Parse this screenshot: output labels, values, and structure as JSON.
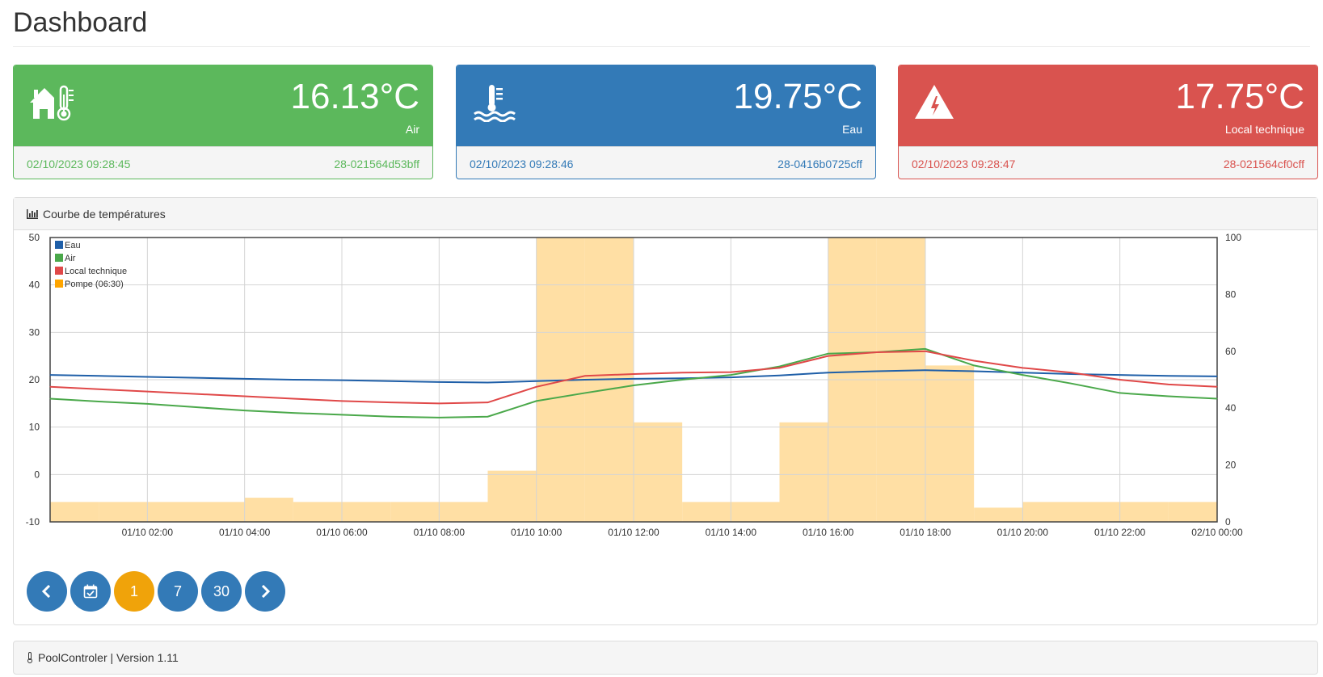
{
  "page": {
    "title": "Dashboard"
  },
  "cards": [
    {
      "value": "16.13°C",
      "label": "Air",
      "timestamp": "02/10/2023 09:28:45",
      "sensor_id": "28-021564d53bff",
      "icon": "house-thermometer-icon",
      "color": "#5cb85c"
    },
    {
      "value": "19.75°C",
      "label": "Eau",
      "timestamp": "02/10/2023 09:28:46",
      "sensor_id": "28-0416b0725cff",
      "icon": "water-temperature-icon",
      "color": "#337ab7"
    },
    {
      "value": "17.75°C",
      "label": "Local technique",
      "timestamp": "02/10/2023 09:28:47",
      "sensor_id": "28-021564cf0cff",
      "icon": "electric-hazard-icon",
      "color": "#d9534f"
    }
  ],
  "chart_panel": {
    "title": "Courbe de températures",
    "icon": "bar-chart-icon"
  },
  "chart_data": {
    "type": "line",
    "title": "",
    "x": [
      "01/10 00:00",
      "01/10 01:00",
      "01/10 02:00",
      "01/10 03:00",
      "01/10 04:00",
      "01/10 05:00",
      "01/10 06:00",
      "01/10 07:00",
      "01/10 08:00",
      "01/10 09:00",
      "01/10 10:00",
      "01/10 11:00",
      "01/10 12:00",
      "01/10 13:00",
      "01/10 14:00",
      "01/10 15:00",
      "01/10 16:00",
      "01/10 17:00",
      "01/10 18:00",
      "01/10 19:00",
      "01/10 20:00",
      "01/10 21:00",
      "01/10 22:00",
      "01/10 23:00",
      "02/10 00:00"
    ],
    "x_tick_labels": [
      "01/10 02:00",
      "01/10 04:00",
      "01/10 06:00",
      "01/10 08:00",
      "01/10 10:00",
      "01/10 12:00",
      "01/10 14:00",
      "01/10 16:00",
      "01/10 18:00",
      "01/10 20:00",
      "01/10 22:00",
      "02/10 00:00"
    ],
    "y_left": {
      "ylim": [
        -10,
        50
      ],
      "ticks": [
        -10,
        0,
        10,
        20,
        30,
        40,
        50
      ]
    },
    "y_right": {
      "ylim": [
        0,
        100
      ],
      "ticks": [
        0,
        20,
        40,
        60,
        80,
        100
      ]
    },
    "legend": "top-left",
    "grid": true,
    "series": [
      {
        "name": "Eau",
        "color": "#1f5fa8",
        "axis": "left",
        "values": [
          21,
          20.8,
          20.6,
          20.4,
          20.2,
          20,
          19.9,
          19.7,
          19.5,
          19.4,
          19.7,
          20,
          20.2,
          20.3,
          20.5,
          20.9,
          21.5,
          21.8,
          22,
          21.8,
          21.5,
          21.2,
          21,
          20.8,
          20.7
        ]
      },
      {
        "name": "Air",
        "color": "#4aa84a",
        "axis": "left",
        "values": [
          16,
          15.4,
          14.9,
          14.2,
          13.5,
          13,
          12.6,
          12.2,
          12,
          12.2,
          15.5,
          17.2,
          18.8,
          20,
          21,
          22.8,
          25.5,
          25.8,
          26.5,
          23,
          21,
          19.2,
          17.2,
          16.5,
          16
        ]
      },
      {
        "name": "Local technique",
        "color": "#e04848",
        "axis": "left",
        "values": [
          18.5,
          18,
          17.5,
          17,
          16.5,
          16,
          15.5,
          15.2,
          15,
          15.2,
          18.5,
          20.8,
          21.2,
          21.5,
          21.6,
          22.5,
          25,
          25.8,
          26,
          24,
          22.5,
          21.5,
          20,
          19,
          18.5
        ]
      },
      {
        "name": "Pompe (06:30)",
        "color": "#ffa500",
        "axis": "right",
        "type": "bar",
        "values": [
          7,
          7,
          7,
          7,
          8.5,
          7,
          7,
          7,
          7,
          18,
          100,
          100,
          35,
          7,
          7,
          35,
          100,
          100,
          55,
          5,
          7,
          7,
          7,
          7
        ]
      }
    ]
  },
  "nav": [
    {
      "label": "",
      "icon": "chevron-left-icon",
      "active": false
    },
    {
      "label": "",
      "icon": "calendar-check-icon",
      "active": false
    },
    {
      "label": "1",
      "icon": "",
      "active": true
    },
    {
      "label": "7",
      "icon": "",
      "active": false
    },
    {
      "label": "30",
      "icon": "",
      "active": false
    },
    {
      "label": "",
      "icon": "chevron-right-icon",
      "active": false
    }
  ],
  "footer": {
    "text": "PoolControler | Version 1.11",
    "icon": "thermometer-icon"
  }
}
